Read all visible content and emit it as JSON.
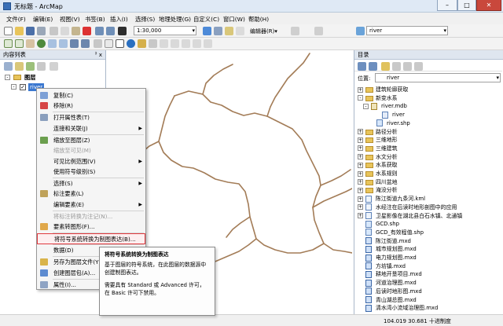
{
  "window": {
    "title": "无标题 - ArcMap"
  },
  "menu": [
    "文件(F)",
    "编辑(E)",
    "视图(V)",
    "书签(B)",
    "插入(I)",
    "选择(S)",
    "地理处理(G)",
    "自定义(C)",
    "窗口(W)",
    "帮助(H)"
  ],
  "toolbar": {
    "scale": "1:30,000",
    "editor": "编辑器(R)▾",
    "layer": "river"
  },
  "toc": {
    "title": "内容列表",
    "pin": "ᅡ x",
    "layers_group": "图层",
    "layer": "river"
  },
  "context_menu": {
    "items": [
      {
        "label": "复制(C)",
        "icon": "copy-icon",
        "disabled": false,
        "sub": false
      },
      {
        "label": "移除(R)",
        "icon": "remove-icon",
        "disabled": false,
        "sub": false
      },
      {
        "label": "打开属性表(T)",
        "icon": "table-icon",
        "disabled": false,
        "sub": false
      },
      {
        "label": "连接和关联(J)",
        "icon": "",
        "disabled": false,
        "sub": true
      },
      {
        "label": "缩放至图层(Z)",
        "icon": "zoom-layer-icon",
        "disabled": false,
        "sub": false
      },
      {
        "label": "缩放至可见(M)",
        "icon": "",
        "disabled": true,
        "sub": false
      },
      {
        "label": "可见比例范围(V)",
        "icon": "",
        "disabled": false,
        "sub": true
      },
      {
        "label": "使用符号级别(S)",
        "icon": "",
        "disabled": false,
        "sub": false
      },
      {
        "label": "选择(S)",
        "icon": "",
        "disabled": false,
        "sub": true
      },
      {
        "label": "标注要素(L)",
        "icon": "label-icon",
        "disabled": false,
        "sub": false
      },
      {
        "label": "编辑要素(E)",
        "icon": "",
        "disabled": false,
        "sub": true
      },
      {
        "label": "将标注转换为注记(N)...",
        "icon": "",
        "disabled": true,
        "sub": false
      },
      {
        "label": "要素转图形(F)...",
        "icon": "graphic-icon",
        "disabled": false,
        "sub": false
      },
      {
        "label": "将符号系统转换为制图表达(B)...",
        "icon": "",
        "disabled": false,
        "sub": false
      },
      {
        "label": "数据(D)",
        "icon": "",
        "disabled": false,
        "sub": true
      },
      {
        "label": "另存为图层文件(Y)...",
        "icon": "save-layer-icon",
        "disabled": false,
        "sub": false
      },
      {
        "label": "创建图层包(A)...",
        "icon": "layer-package-icon",
        "disabled": false,
        "sub": false
      },
      {
        "label": "属性(I)...",
        "icon": "properties-icon",
        "disabled": false,
        "sub": false
      }
    ]
  },
  "tooltip": {
    "title": "将符号系统转换为制图表达",
    "p1": "基于图层的符号系统，在此图层的数据源中创建制图表达。",
    "p2": "需要具有 Standard 或 Advanced 许可，在 Basic 许可下禁用。"
  },
  "catalog": {
    "title": "目录",
    "location_label": "位置:",
    "location": "river",
    "items": [
      {
        "label": "建筑轮廓获取",
        "type": "folder",
        "indent": 2,
        "expander": "+"
      },
      {
        "label": "新变水系",
        "type": "folder",
        "indent": 2,
        "expander": "-"
      },
      {
        "label": "river.mdb",
        "type": "mdb",
        "indent": 3,
        "expander": "-"
      },
      {
        "label": "river",
        "type": "fc",
        "indent": 5,
        "expander": ""
      },
      {
        "label": "river.shp",
        "type": "shp",
        "indent": 4,
        "expander": ""
      },
      {
        "label": "路径分析",
        "type": "folder",
        "indent": 2,
        "expander": "+"
      },
      {
        "label": "三维地形",
        "type": "folder",
        "indent": 2,
        "expander": "+"
      },
      {
        "label": "三维建筑",
        "type": "folder",
        "indent": 2,
        "expander": "+"
      },
      {
        "label": "水文分析",
        "type": "folder",
        "indent": 2,
        "expander": "+"
      },
      {
        "label": "水系获取",
        "type": "folder",
        "indent": 2,
        "expander": "+"
      },
      {
        "label": "水系规则",
        "type": "folder",
        "indent": 2,
        "expander": "+"
      },
      {
        "label": "四川盆地",
        "type": "folder",
        "indent": 2,
        "expander": "+"
      },
      {
        "label": "淹没分析",
        "type": "folder",
        "indent": 2,
        "expander": "+"
      },
      {
        "label": "陈江街道九条河.kml",
        "type": "file",
        "indent": 2,
        "expander": "+"
      },
      {
        "label": "水经注在后读时地形剖图中的应用",
        "type": "file",
        "indent": 2,
        "expander": "+"
      },
      {
        "label": "卫星影像在湖北县白石水镇、北通镇",
        "type": "file",
        "indent": 2,
        "expander": "+"
      },
      {
        "label": "GCD.shp",
        "type": "shp",
        "indent": 2,
        "expander": ""
      },
      {
        "label": "GCD_有效程值.shp",
        "type": "shp",
        "indent": 2,
        "expander": ""
      },
      {
        "label": "陈江街道.mxd",
        "type": "mxd",
        "indent": 2,
        "expander": ""
      },
      {
        "label": "城市规划图.mxd",
        "type": "mxd",
        "indent": 2,
        "expander": ""
      },
      {
        "label": "电力规划图.mxd",
        "type": "mxd",
        "indent": 2,
        "expander": ""
      },
      {
        "label": "方坊镇.mxd",
        "type": "mxd",
        "indent": 2,
        "expander": ""
      },
      {
        "label": "耕地开垦项目.mxd",
        "type": "mxd",
        "indent": 2,
        "expander": ""
      },
      {
        "label": "河道治理图.mxd",
        "type": "mxd",
        "indent": 2,
        "expander": ""
      },
      {
        "label": "后读时地形图.mxd",
        "type": "mxd",
        "indent": 2,
        "expander": ""
      },
      {
        "label": "青山湖总图.mxd",
        "type": "mxd",
        "indent": 2,
        "expander": ""
      },
      {
        "label": "清水湾小流域治理图.mxd",
        "type": "mxd",
        "indent": 2,
        "expander": ""
      }
    ]
  },
  "status": {
    "coords": "104.019  30.681 十进制度"
  },
  "colors": {
    "river_line": "#a37c57",
    "highlight": "#e0393e"
  }
}
